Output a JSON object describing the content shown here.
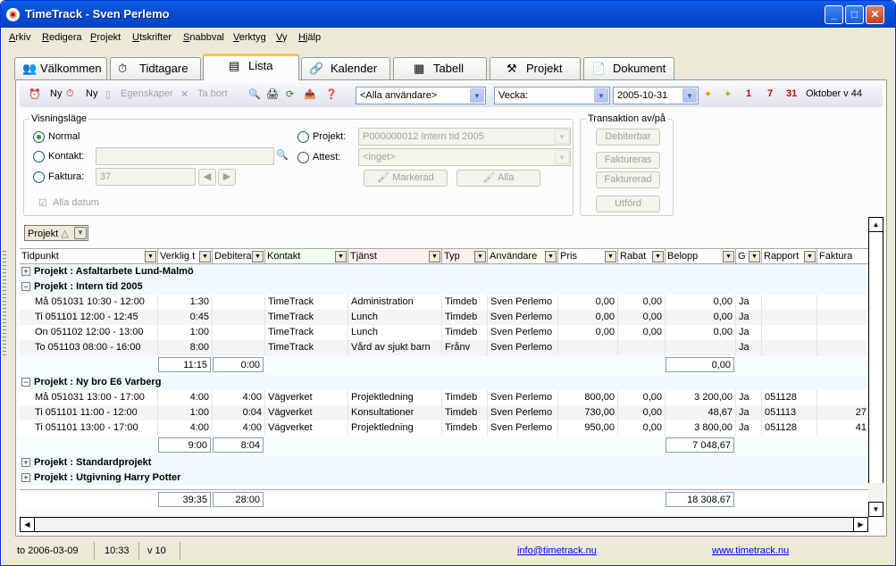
{
  "window": {
    "title": "TimeTrack - Sven Perlemo"
  },
  "menu": [
    "Arkiv",
    "Redigera",
    "Projekt",
    "Utskrifter",
    "Snabbval",
    "Verktyg",
    "Vy",
    "Hjälp"
  ],
  "tabs": [
    {
      "label": "Välkommen",
      "icon": "👥"
    },
    {
      "label": "Tidtagare",
      "icon": "⏱"
    },
    {
      "label": "Lista",
      "icon": "▤"
    },
    {
      "label": "Kalender",
      "icon": "🔗"
    },
    {
      "label": "Tabell",
      "icon": "▦"
    },
    {
      "label": "Projekt",
      "icon": "⚒"
    },
    {
      "label": "Dokument",
      "icon": "📄"
    }
  ],
  "toolbar": {
    "new1": "Ny",
    "new2": "Ny",
    "properties": "Egenskaper",
    "delete": "Ta bort",
    "users": "<Alla användare>",
    "period": "Vecka:",
    "date": "2005-10-31",
    "period_label": "Oktober v 44",
    "cal1": "1",
    "cal7": "7",
    "cal31": "31"
  },
  "view": {
    "title": "Visningsläge",
    "normal": "Normal",
    "kontakt": "Kontakt:",
    "faktura": "Faktura:",
    "faktura_value": "37",
    "alla_datum": "Alla datum",
    "projekt": "Projekt:",
    "projekt_value": "P000000012     Intern tid 2005",
    "attest": "Attest:",
    "attest_value": "<inget>",
    "markerad": "Markerad",
    "alla": "Alla"
  },
  "transaction": {
    "title": "Transaktion av/på",
    "debiterbar": "Debiterbar",
    "faktureras": "Faktureras",
    "fakturerad": "Fakturerad",
    "utford": "Utförd"
  },
  "groupby": "Projekt",
  "columns": [
    "Tidpunkt",
    "Verklig t",
    "Debitera",
    "Kontakt",
    "Tjänst",
    "Typ",
    "Användare",
    "Pris",
    "Rabat",
    "Belopp",
    "G",
    "Rapport",
    "Faktura"
  ],
  "groups": [
    {
      "name": "Projekt : Asfaltarbete Lund-Malmö",
      "expanded": false
    },
    {
      "name": "Projekt : Intern tid 2005",
      "expanded": true,
      "rows": [
        [
          "Må 051031  10:30 - 12:00",
          "1:30",
          "",
          "TimeTrack",
          "Administration",
          "Timdeb",
          "Sven Perlemo",
          "0,00",
          "0,00",
          "0,00",
          "Ja",
          "",
          ""
        ],
        [
          "Ti  051101  12:00 - 12:45",
          "0:45",
          "",
          "TimeTrack",
          "Lunch",
          "Timdeb",
          "Sven Perlemo",
          "0,00",
          "0,00",
          "0,00",
          "Ja",
          "",
          ""
        ],
        [
          "On 051102  12:00 - 13:00",
          "1:00",
          "",
          "TimeTrack",
          "Lunch",
          "Timdeb",
          "Sven Perlemo",
          "0,00",
          "0,00",
          "0,00",
          "Ja",
          "",
          ""
        ],
        [
          "To  051103  08:00 - 16:00",
          "8:00",
          "",
          "TimeTrack",
          "Vård av sjukt barn",
          "Frånv",
          "Sven Perlemo",
          "",
          "",
          "",
          "Ja",
          "",
          ""
        ]
      ],
      "sum": [
        "11:15",
        "0:00",
        "0,00"
      ]
    },
    {
      "name": "Projekt : Ny bro E6 Varberg",
      "expanded": true,
      "rows": [
        [
          "Må 051031  13:00 - 17:00",
          "4:00",
          "4:00",
          "Vägverket",
          "Projektledning",
          "Timdeb",
          "Sven Perlemo",
          "800,00",
          "0,00",
          "3 200,00",
          "Ja",
          "051128",
          ""
        ],
        [
          "Ti  051101  11:00 - 12:00",
          "1:00",
          "0:04",
          "Vägverket",
          "Konsultationer",
          "Timdeb",
          "Sven Perlemo",
          "730,00",
          "0,00",
          "48,67",
          "Ja",
          "051113",
          "27"
        ],
        [
          "Ti  051101  13:00 - 17:00",
          "4:00",
          "4:00",
          "Vägverket",
          "Projektledning",
          "Timdeb",
          "Sven Perlemo",
          "950,00",
          "0,00",
          "3 800,00",
          "Ja",
          "051128",
          "41"
        ]
      ],
      "sum": [
        "9:00",
        "8:04",
        "7 048,67"
      ]
    },
    {
      "name": "Projekt : Standardprojekt",
      "expanded": false
    },
    {
      "name": "Projekt : Utgivning Harry Potter",
      "expanded": false
    }
  ],
  "totals": [
    "39:35",
    "28:00",
    "18 308,67"
  ],
  "status": {
    "date": "to 2006-03-09",
    "time": "10:33",
    "week": "v 10",
    "email": "info@timetrack.nu",
    "web": "www.timetrack.nu"
  }
}
